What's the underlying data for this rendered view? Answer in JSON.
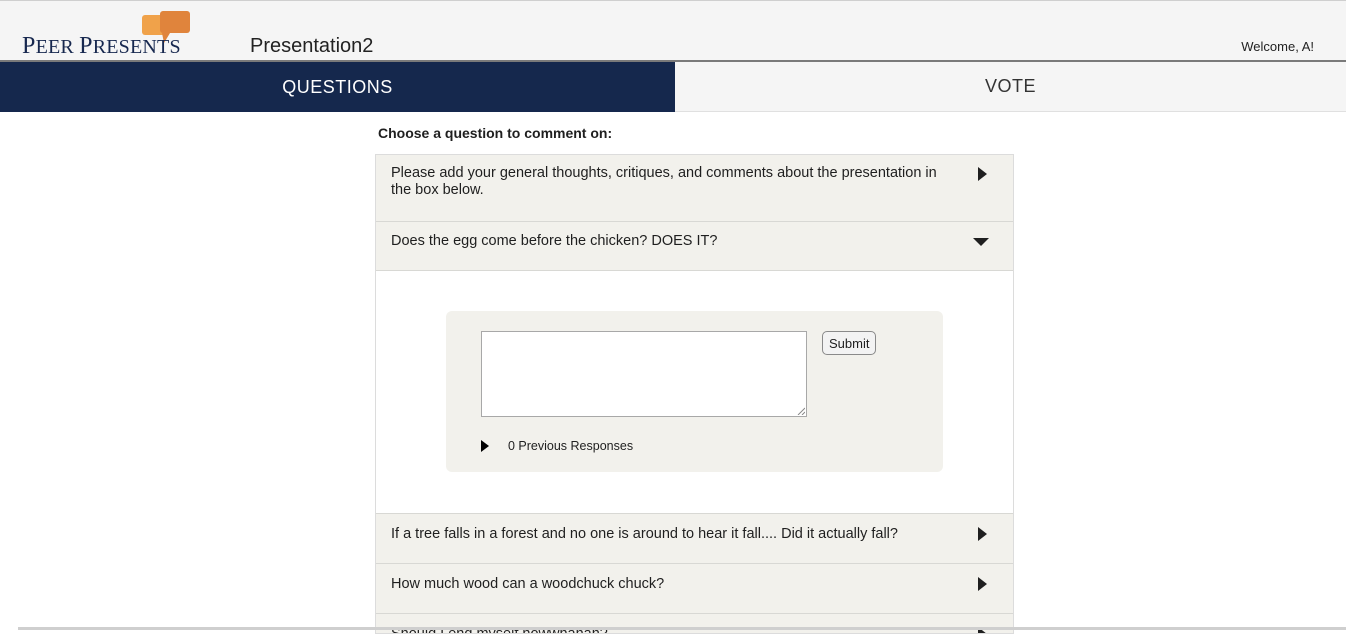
{
  "header": {
    "logo_text_first": "P",
    "logo_text_rest1": "EER ",
    "logo_text_second": "P",
    "logo_text_rest2": "RESENTS",
    "presentation_title": "Presentation2",
    "welcome": "Welcome, A!"
  },
  "tabs": [
    {
      "label": "QUESTIONS",
      "active": true
    },
    {
      "label": "VOTE",
      "active": false
    }
  ],
  "main": {
    "choose_label": "Choose a question to comment on:",
    "questions": [
      {
        "text": "Please add your general thoughts, critiques, and comments about the presentation in the box below.",
        "expanded": false
      },
      {
        "text": "Does the egg come before the chicken? DOES IT?",
        "expanded": true
      },
      {
        "text": "If a tree falls in a forest and no one is around to hear it fall.... Did it actually fall?",
        "expanded": false
      },
      {
        "text": "How much wood can a woodchuck chuck?",
        "expanded": false
      },
      {
        "text": "Should I end myself nowwhahah?",
        "expanded": false
      }
    ],
    "comment": {
      "value": "",
      "submit_label": "Submit",
      "previous_responses": "0 Previous Responses"
    }
  },
  "colors": {
    "nav_active": "#15284d",
    "row_bg": "#f2f1ec",
    "logo_orange": "#e0843c",
    "logo_navy": "#17284f"
  },
  "icons": {
    "collapsed": "triangle-right-icon",
    "expanded": "triangle-down-icon"
  }
}
